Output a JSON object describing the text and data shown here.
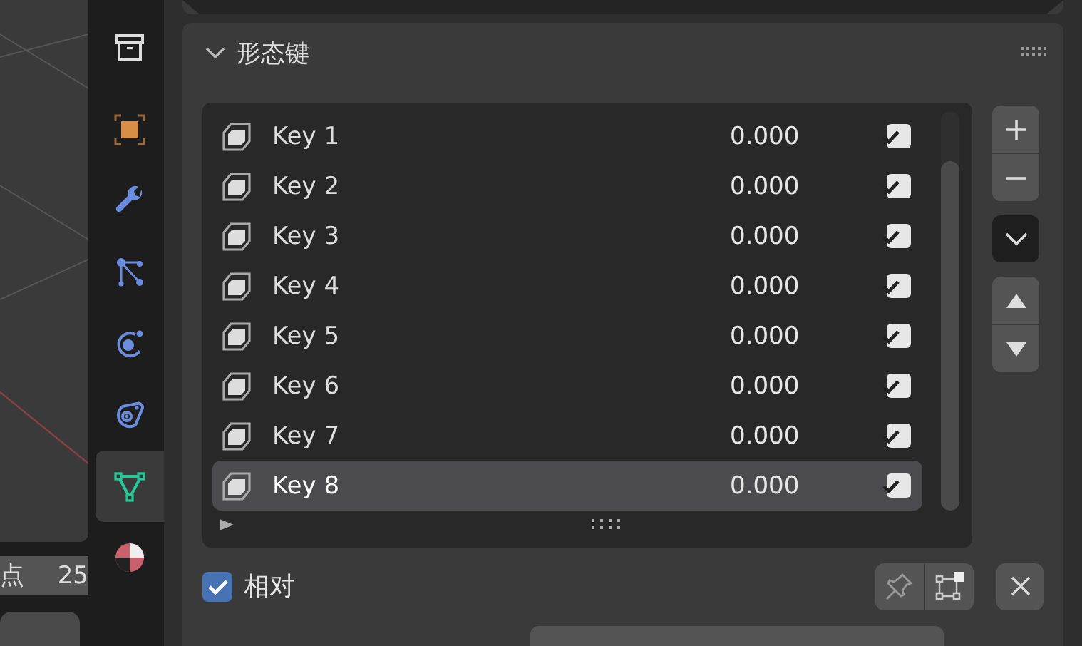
{
  "viewport": {
    "field_label": "点",
    "field_value": "25"
  },
  "tabs": [
    {
      "kind": "scene",
      "selected": false
    },
    {
      "kind": "object",
      "selected": false
    },
    {
      "kind": "modifier",
      "selected": false
    },
    {
      "kind": "particles",
      "selected": false
    },
    {
      "kind": "physics",
      "selected": false
    },
    {
      "kind": "constraints",
      "selected": false
    },
    {
      "kind": "data",
      "selected": true
    },
    {
      "kind": "material",
      "selected": false
    }
  ],
  "panel": {
    "title": "形态键",
    "expanded": true,
    "shape_keys": [
      {
        "name": "Key 1",
        "value": "0.000",
        "checked": true,
        "selected": false
      },
      {
        "name": "Key 2",
        "value": "0.000",
        "checked": true,
        "selected": false
      },
      {
        "name": "Key 3",
        "value": "0.000",
        "checked": true,
        "selected": false
      },
      {
        "name": "Key 4",
        "value": "0.000",
        "checked": true,
        "selected": false
      },
      {
        "name": "Key 5",
        "value": "0.000",
        "checked": true,
        "selected": false
      },
      {
        "name": "Key 6",
        "value": "0.000",
        "checked": true,
        "selected": false
      },
      {
        "name": "Key 7",
        "value": "0.000",
        "checked": true,
        "selected": false
      },
      {
        "name": "Key 8",
        "value": "0.000",
        "checked": true,
        "selected": true
      }
    ],
    "relative": {
      "label": "相对",
      "checked": true
    }
  }
}
